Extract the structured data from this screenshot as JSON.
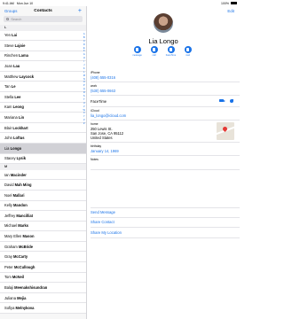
{
  "status": {
    "time": "9:41 AM",
    "date": "Mon Jun 10",
    "battery": "100%"
  },
  "sidebar": {
    "groups_label": "Groups",
    "title": "Contacts",
    "add_label": "+",
    "search_placeholder": "Search",
    "section_top": "L",
    "rows_l": [
      {
        "first": "Yen",
        "last": "Lai"
      },
      {
        "first": "Steve",
        "last": "Lajoie"
      },
      {
        "first": "Rinchen",
        "last": "Lama"
      },
      {
        "first": "Joan",
        "last": "Lau"
      },
      {
        "first": "Matthew",
        "last": "Laycock"
      },
      {
        "first": "Tan",
        "last": "Le"
      },
      {
        "first": "Stella",
        "last": "Lee"
      },
      {
        "first": "Kam",
        "last": "Leong"
      },
      {
        "first": "Mariana",
        "last": "Lin"
      },
      {
        "first": "Blair",
        "last": "Lockhart"
      },
      {
        "first": "John",
        "last": "Loftus"
      },
      {
        "first": "Lia",
        "last": "Longo"
      },
      {
        "first": "Stacey",
        "last": "Lysik"
      }
    ],
    "section_m": "M",
    "rows_m": [
      {
        "first": "Ian",
        "last": "Macinder"
      },
      {
        "first": "David",
        "last": "Mah Ming"
      },
      {
        "first": "Noel",
        "last": "Mallari"
      },
      {
        "first": "Kelly",
        "last": "Mandon"
      },
      {
        "first": "Jeffrey",
        "last": "Mancilliat"
      },
      {
        "first": "Michael",
        "last": "Marks"
      },
      {
        "first": "Mary Ellen",
        "last": "Mason"
      },
      {
        "first": "Graham",
        "last": "McBride"
      },
      {
        "first": "Gray",
        "last": "McCarty"
      },
      {
        "first": "Peter",
        "last": "McCullough"
      },
      {
        "first": "Tom",
        "last": "McNeil"
      },
      {
        "first": "Balaji",
        "last": "Meenakshisundran"
      },
      {
        "first": "Juliana",
        "last": "Mejia"
      },
      {
        "first": "Sofiya",
        "last": "Melnykova"
      }
    ],
    "index_letters": [
      "A",
      "B",
      "C",
      "D",
      "E",
      "F",
      "G",
      "H",
      "I",
      "J",
      "K",
      "L",
      "M",
      "N",
      "O",
      "P",
      "Q",
      "R",
      "S",
      "T",
      "U",
      "V",
      "W",
      "X",
      "Y",
      "Z",
      "#"
    ]
  },
  "detail": {
    "edit_label": "Edit",
    "name": "Lia Longo",
    "actions": [
      {
        "label": "message",
        "icon": "message-icon"
      },
      {
        "label": "call",
        "icon": "phone-icon"
      },
      {
        "label": "FaceTime",
        "icon": "video-icon"
      },
      {
        "label": "mail",
        "icon": "mail-icon"
      }
    ],
    "iphone_label": "iPhone",
    "iphone_value": "(408) 555-0316",
    "work_label": "work",
    "work_value": "(530) 555-0663",
    "facetime_label": "FaceTime",
    "icloud_label": "iCloud",
    "icloud_value": "lia_longo@icloud.com",
    "home_label": "home",
    "address_line1": "250 Lewis St.",
    "address_line2": "San Jose, CA 95112",
    "address_line3": "United States",
    "birthday_label": "birthday",
    "birthday_value": "January 14, 1969",
    "notes_label": "Notes",
    "links": [
      "Send Message",
      "Share Contact",
      "Share My Location"
    ]
  }
}
